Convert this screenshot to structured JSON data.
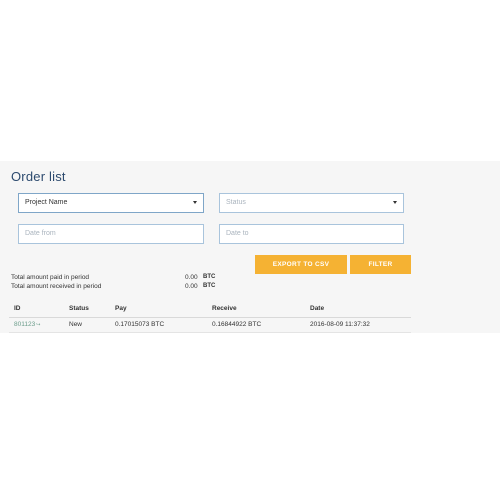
{
  "page": {
    "title": "Order list"
  },
  "filters": {
    "project_select": {
      "value": "Project Name"
    },
    "status_select": {
      "placeholder": "Status"
    },
    "date_from": {
      "placeholder": "Date from"
    },
    "date_to": {
      "placeholder": "Date to"
    }
  },
  "actions": {
    "export_label": "EXPORT TO CSV",
    "filter_label": "FILTER"
  },
  "summary": {
    "paid": {
      "label": "Total amount paid in period",
      "value": "0.00",
      "unit": "BTC"
    },
    "received": {
      "label": "Total amount received in period",
      "value": "0.00",
      "unit": "BTC"
    }
  },
  "table": {
    "columns": [
      "ID",
      "Status",
      "Pay",
      "Receive",
      "Date"
    ],
    "rows": [
      {
        "id": "801123",
        "status": "New",
        "pay": "0.17015073 BTC",
        "receive": "0.16844922 BTC",
        "date": "2016-08-09 11:37:32"
      }
    ]
  },
  "icons": {
    "caret": "chevron-down-icon",
    "external": "external-link-icon"
  },
  "colors": {
    "accent_button": "#f5b233",
    "title": "#2c4a6e",
    "link": "#6a9c8a",
    "field_border": "#a9c4dc",
    "panel_bg": "#f6f6f6"
  }
}
